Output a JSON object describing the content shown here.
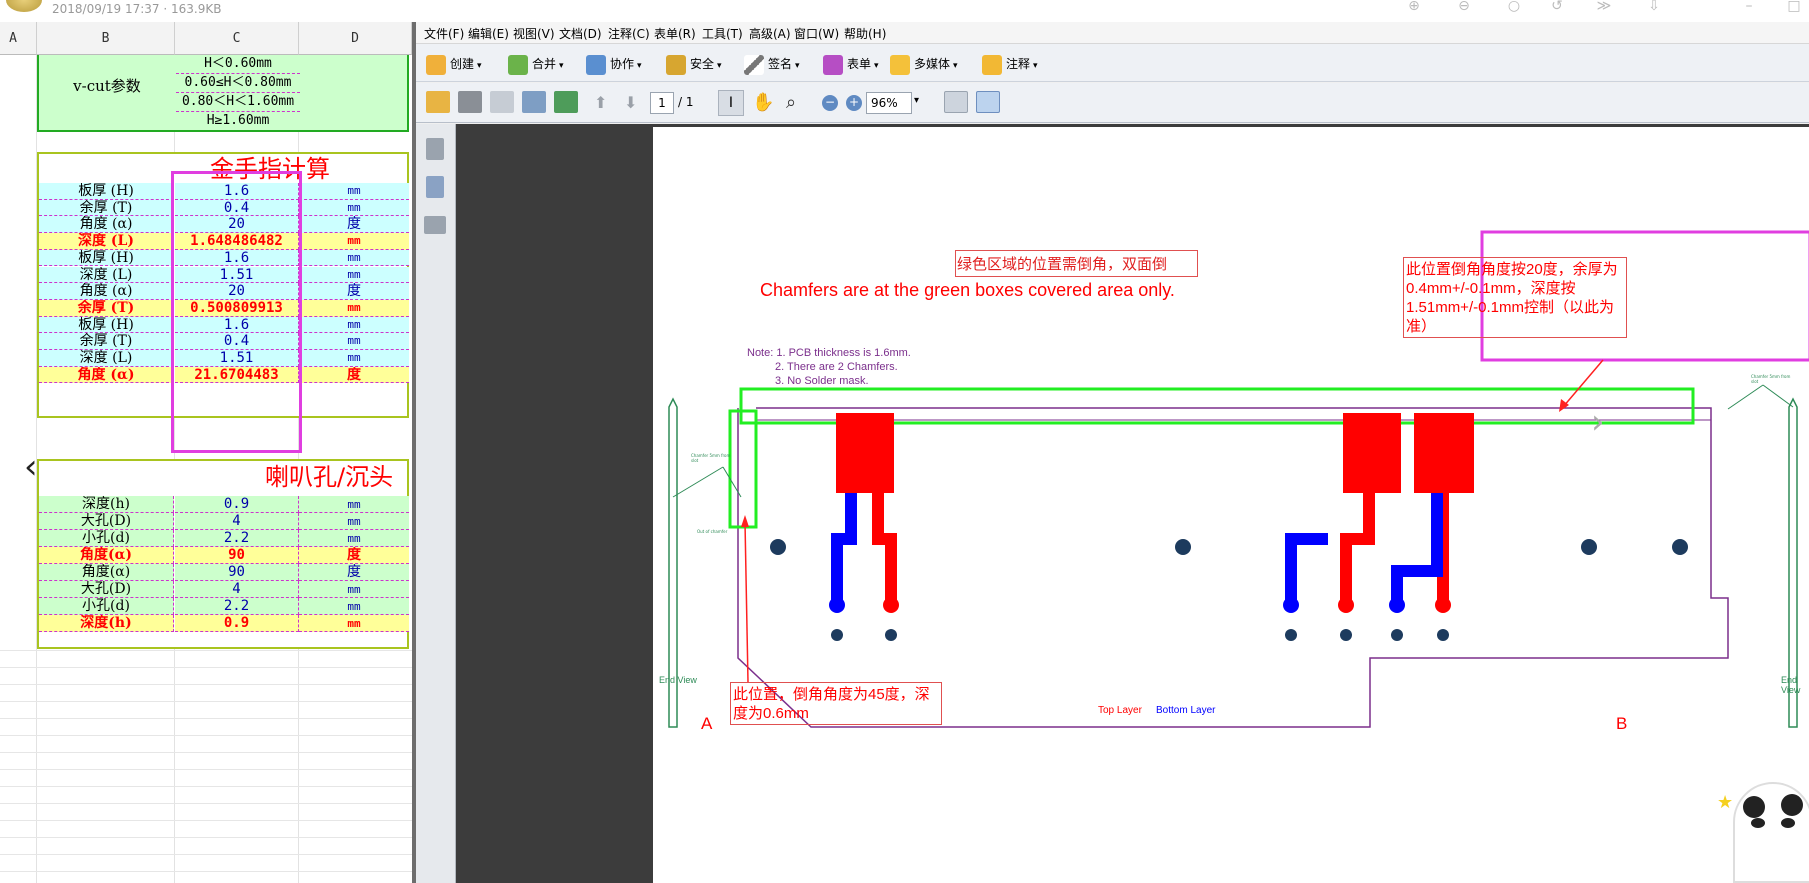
{
  "top": {
    "file_info": "2018/09/19 17:37 · 163.9KB"
  },
  "excel": {
    "columns": [
      "A",
      "B",
      "C",
      "D"
    ],
    "vcut": {
      "label": "v-cut参数",
      "rows": [
        "H＜0.60mm",
        "0.60≤H＜0.80mm",
        "0.80＜H＜1.60mm",
        "H≥1.60mm"
      ]
    },
    "gold": {
      "title": "金手指计算",
      "rows": [
        {
          "label": "板厚 (H)",
          "value": "1.6",
          "unit": "mm",
          "style": "cyan"
        },
        {
          "label": "余厚 (T)",
          "value": "0.4",
          "unit": "mm",
          "style": "cyan"
        },
        {
          "label": "角度 (α)",
          "value": "20",
          "unit": "度",
          "style": "cyan"
        },
        {
          "label": "深度 (L)",
          "value": "1.648486482",
          "unit": "mm",
          "style": "yellow"
        },
        {
          "label": "板厚 (H)",
          "value": "1.6",
          "unit": "mm",
          "style": "cyan"
        },
        {
          "label": "深度 (L)",
          "value": "1.51",
          "unit": "mm",
          "style": "cyan"
        },
        {
          "label": "角度 (α)",
          "value": "20",
          "unit": "度",
          "style": "cyan"
        },
        {
          "label": "余厚 (T)",
          "value": "0.500809913",
          "unit": "mm",
          "style": "yellow"
        },
        {
          "label": "板厚 (H)",
          "value": "1.6",
          "unit": "mm",
          "style": "cyan"
        },
        {
          "label": "余厚 (T)",
          "value": "0.4",
          "unit": "mm",
          "style": "cyan"
        },
        {
          "label": "深度 (L)",
          "value": "1.51",
          "unit": "mm",
          "style": "cyan"
        },
        {
          "label": "角度 (α)",
          "value": "21.6704483",
          "unit": "度",
          "style": "yellow"
        }
      ]
    },
    "horn": {
      "title": "喇叭孔/沉头",
      "rows": [
        {
          "label": "深度(h)",
          "value": "0.9",
          "unit": "mm",
          "style": "green"
        },
        {
          "label": "大孔(D)",
          "value": "4",
          "unit": "mm",
          "style": "green"
        },
        {
          "label": "小孔(d)",
          "value": "2.2",
          "unit": "mm",
          "style": "green"
        },
        {
          "label": "角度(α)",
          "value": "90",
          "unit": "度",
          "style": "yellow"
        },
        {
          "label": "角度(α)",
          "value": "90",
          "unit": "度",
          "style": "green"
        },
        {
          "label": "大孔(D)",
          "value": "4",
          "unit": "mm",
          "style": "green"
        },
        {
          "label": "小孔(d)",
          "value": "2.2",
          "unit": "mm",
          "style": "green"
        },
        {
          "label": "深度(h)",
          "value": "0.9",
          "unit": "mm",
          "style": "yellow"
        }
      ]
    }
  },
  "pdf": {
    "menu": [
      "文件(F)",
      "编辑(E)",
      "视图(V)",
      "文档(D)",
      "注释(C)",
      "表单(R)",
      "工具(T)",
      "高级(A)",
      "窗口(W)",
      "帮助(H)"
    ],
    "toolbar1": [
      "创建",
      "合并",
      "协作",
      "安全",
      "签名",
      "表单",
      "多媒体",
      "注释"
    ],
    "page_input": "1",
    "page_total": "/ 1",
    "zoom": "96%",
    "doc": {
      "cn_note": "绿色区域的位置需倒角，双面倒",
      "en_note": "Chamfers are at the green boxes covered area only.",
      "note_lines": [
        "Note: 1. PCB thickness is 1.6mm.",
        "2. There are 2 Chamfers.",
        "3. No Solder mask."
      ],
      "callout_right": "此位置倒角角度按20度，余厚为0.4mm+/-0.1mm，深度按1.51mm+/-0.1mm控制（以此为准）",
      "callout_left": "此位置，倒角角度为45度，深度为0.6mm",
      "label_a": "A",
      "label_b": "B",
      "end_view_left": "End View",
      "end_view_right": "End View",
      "legend_top": "Top Layer",
      "legend_bottom": "Bottom Layer",
      "tiny_left_1": "Chamfer 5mm from slot",
      "tiny_left_2": "Out of chamfer",
      "tiny_right": "Chamfer 5mm from slot"
    }
  }
}
